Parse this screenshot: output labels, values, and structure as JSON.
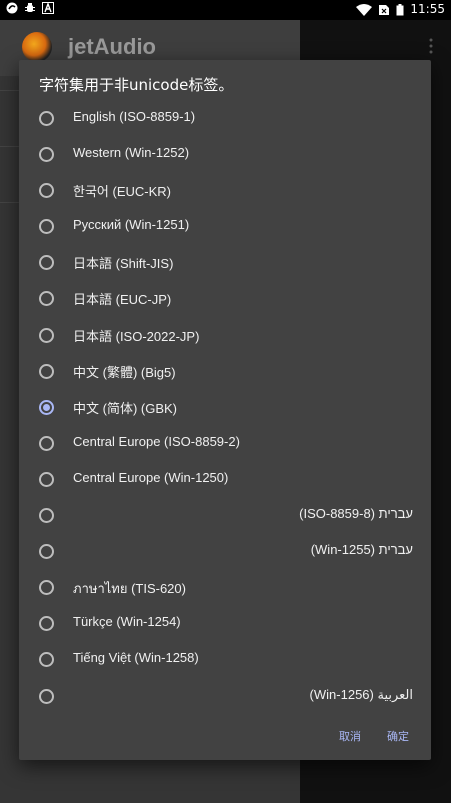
{
  "status_bar": {
    "time": "11:55",
    "left_icons": [
      "app-notification-icon",
      "bug-icon",
      "a-box-icon"
    ],
    "right_icons": [
      "wifi-icon",
      "sim-x-icon",
      "battery-icon"
    ]
  },
  "app": {
    "title": "jetAudio"
  },
  "dialog": {
    "title": "字符集用于非unicode标签。",
    "options": [
      {
        "label": "English (ISO-8859-1)",
        "checked": false,
        "rtl": false
      },
      {
        "label": "Western (Win-1252)",
        "checked": false,
        "rtl": false
      },
      {
        "label": "한국어 (EUC-KR)",
        "checked": false,
        "rtl": false
      },
      {
        "label": "Русский (Win-1251)",
        "checked": false,
        "rtl": false
      },
      {
        "label": "日本語 (Shift-JIS)",
        "checked": false,
        "rtl": false
      },
      {
        "label": "日本語 (EUC-JP)",
        "checked": false,
        "rtl": false
      },
      {
        "label": "日本語 (ISO-2022-JP)",
        "checked": false,
        "rtl": false
      },
      {
        "label": "中文 (繁體) (Big5)",
        "checked": false,
        "rtl": false
      },
      {
        "label": "中文 (简体) (GBK)",
        "checked": true,
        "rtl": false
      },
      {
        "label": "Central Europe (ISO-8859-2)",
        "checked": false,
        "rtl": false
      },
      {
        "label": "Central Europe (Win-1250)",
        "checked": false,
        "rtl": false
      },
      {
        "label": "עברית (ISO-8859-8)",
        "checked": false,
        "rtl": true
      },
      {
        "label": "עברית (Win-1255)",
        "checked": false,
        "rtl": true
      },
      {
        "label": "ภาษาไทย (TIS-620)",
        "checked": false,
        "rtl": false
      },
      {
        "label": "Türkçe (Win-1254)",
        "checked": false,
        "rtl": false
      },
      {
        "label": "Tiếng Việt (Win-1258)",
        "checked": false,
        "rtl": false
      },
      {
        "label": "العربية (Win-1256)",
        "checked": false,
        "rtl": true
      }
    ],
    "cancel_label": "取消",
    "ok_label": "确定"
  },
  "colors": {
    "accent": "#a9b7f5",
    "dialog_bg": "#424242",
    "text": "#f0f0f0"
  }
}
